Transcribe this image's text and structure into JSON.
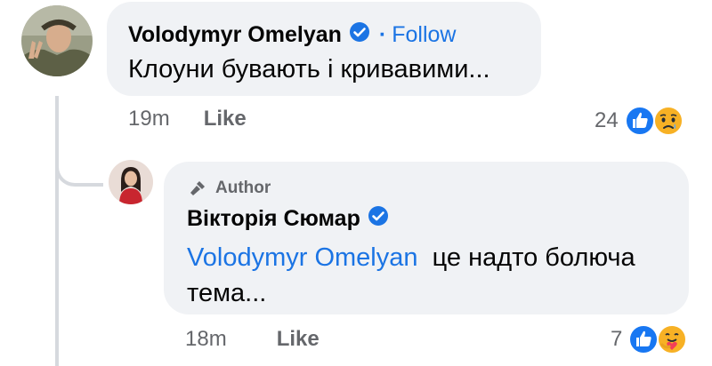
{
  "comment": {
    "author": "Volodymyr Omelyan",
    "follow_label": "Follow",
    "separator": "·",
    "text": "Клоуни бувають і кривавими...",
    "time": "19m",
    "like_label": "Like",
    "reaction_count": "24",
    "reactions": [
      "like-icon",
      "sad-icon"
    ]
  },
  "reply": {
    "badge": "Author",
    "author": "Вікторія Сюмар",
    "mention": "Volodymyr Omelyan",
    "text_line1": "це надто болюча",
    "text_line2": "тема...",
    "time": "18m",
    "like_label": "Like",
    "reaction_count": "7",
    "reactions": [
      "like-icon",
      "care-icon"
    ]
  },
  "colors": {
    "accent": "#1b74e4",
    "bubble": "#f0f2f5",
    "meta": "#65676b",
    "thread_line": "#d6d9de"
  }
}
